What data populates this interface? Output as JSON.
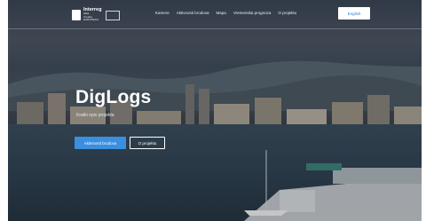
{
  "brand": {
    "name": "Interreg",
    "sub_lines": [
      "Italia",
      "Croatia",
      "EUROPEAN"
    ],
    "mark_icon": "interreg-logo-icon",
    "flag_icon": "eu-flag-icon"
  },
  "nav": {
    "items": [
      {
        "label": "Kamere"
      },
      {
        "label": "Aktivnosti brodova"
      },
      {
        "label": "Mapa"
      },
      {
        "label": "Vremenska prognoza"
      },
      {
        "label": "O projektu"
      }
    ],
    "language_button": "English"
  },
  "hero": {
    "title": "DigLogs",
    "subtitle": "Kratki opis projekta",
    "primary_button": "Aktivnosti brodova",
    "secondary_button": "O projektu"
  },
  "colors": {
    "accent": "#3a8fe0",
    "text_light": "#ffffff"
  }
}
